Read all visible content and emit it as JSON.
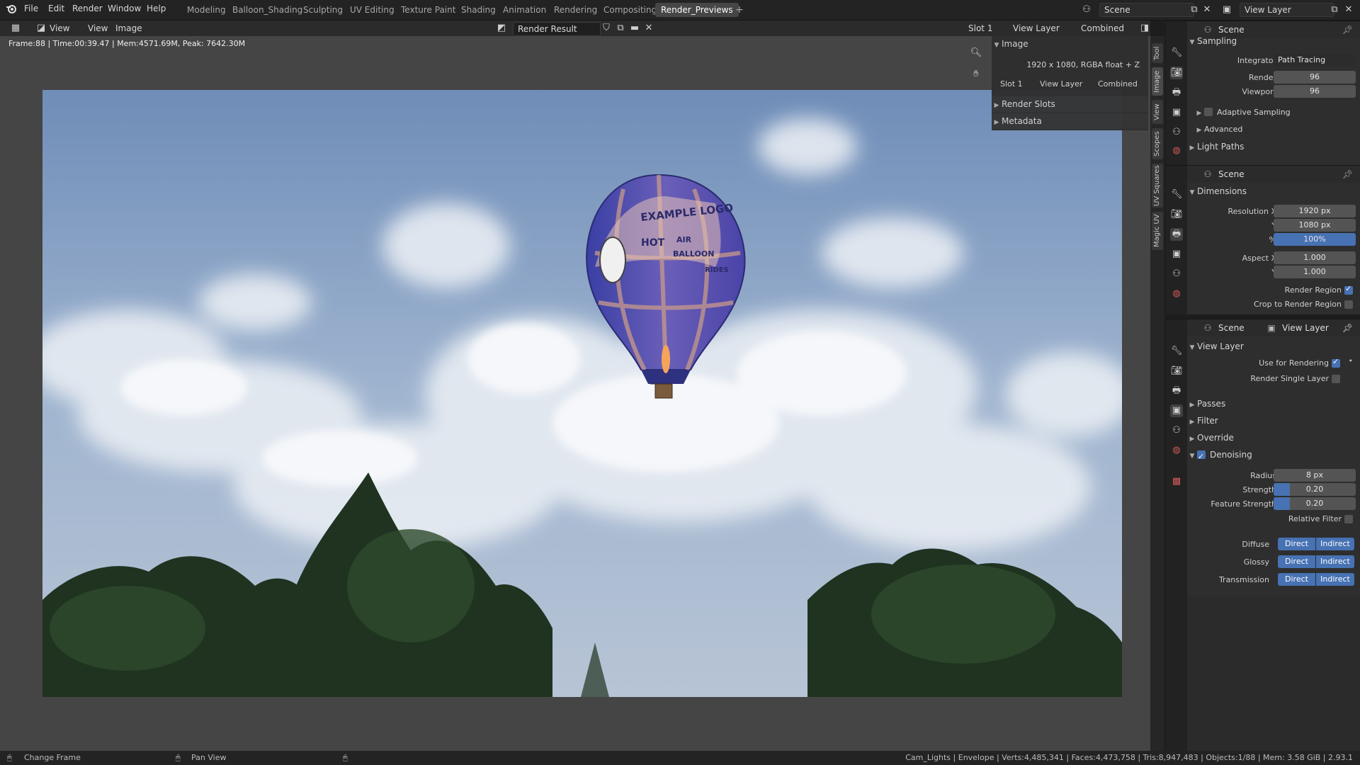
{
  "menu": [
    "File",
    "Edit",
    "Render",
    "Window",
    "Help"
  ],
  "workspaces": [
    "Modeling",
    "Balloon_Shading",
    "Sculpting",
    "UV Editing",
    "Texture Paint",
    "Shading",
    "Animation",
    "Rendering",
    "Compositing",
    "Render_Previews"
  ],
  "active_workspace": "Render_Previews",
  "scene_field": "Scene",
  "viewlayer_field": "View Layer",
  "image_editor": {
    "view_menu": "View",
    "view_menu2": "View",
    "image_menu": "Image",
    "image_name": "Render Result",
    "slot": "Slot 1",
    "layer": "View Layer",
    "pass": "Combined",
    "stats": "Frame:88 | Time:00:39.47 | Mem:4571.69M, Peak: 7642.30M"
  },
  "npanel": {
    "header": "Image",
    "info": "1920 x 1080,  RGBA float + Z",
    "slot": "Slot 1",
    "layer": "View Layer",
    "pass": "Combined",
    "render_slots": "Render Slots",
    "metadata": "Metadata"
  },
  "side_tabs": [
    "Tool",
    "Image",
    "View",
    "Scopes",
    "UV Squares",
    "Magic UV"
  ],
  "render_image": {
    "balloon_text": [
      "EXAMPLE LOGO",
      "HOT",
      "AIR",
      "BALLOON",
      "RIDES"
    ]
  },
  "props1": {
    "scene": "Scene",
    "section": "Sampling",
    "integrator_label": "Integrator",
    "integrator": "Path Tracing",
    "render_label": "Render",
    "render": "96",
    "viewport_label": "Viewport",
    "viewport": "96",
    "adaptive": "Adaptive Sampling",
    "advanced": "Advanced",
    "light_paths": "Light Paths"
  },
  "props2": {
    "scene": "Scene",
    "section": "Dimensions",
    "resx_label": "Resolution X",
    "resx": "1920 px",
    "resy_label": "Y",
    "resy": "1080 px",
    "pct_label": "%",
    "pct": "100%",
    "aspx_label": "Aspect X",
    "aspx": "1.000",
    "aspy_label": "Y",
    "aspy": "1.000",
    "render_region": "Render Region",
    "crop": "Crop to Render Region"
  },
  "props3": {
    "scene": "Scene",
    "view_layer": "View Layer",
    "section": "View Layer",
    "use_for_rendering": "Use for Rendering",
    "render_single": "Render Single Layer",
    "passes": "Passes",
    "filter": "Filter",
    "override": "Override",
    "denoising": "Denoising",
    "radius_label": "Radius",
    "radius": "8 px",
    "strength_label": "Strength",
    "strength": "0.20",
    "feature_label": "Feature Strength",
    "feature": "0.20",
    "relative": "Relative Filter",
    "diffuse": "Diffuse",
    "glossy": "Glossy",
    "transmission": "Transmission",
    "direct": "Direct",
    "indirect": "Indirect"
  },
  "status": {
    "change_frame": "Change Frame",
    "pan_view": "Pan View",
    "stats": "Cam_Lights | Envelope | Verts:4,485,341 | Faces:4,473,758 | Tris:8,947,483 | Objects:1/88 | Mem: 3.58 GiB | 2.93.1"
  },
  "colors": {
    "accent": "#4772b3",
    "sky": "#8fa6c6"
  },
  "values": {
    "strength_fill": 0.2,
    "feature_fill": 0.2
  }
}
